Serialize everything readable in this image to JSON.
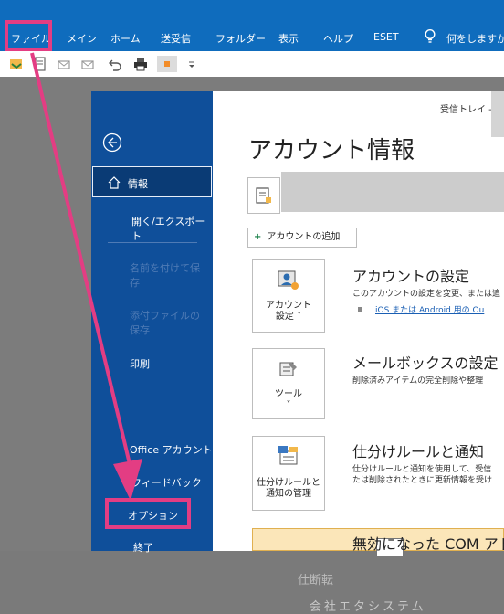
{
  "ribbon": {
    "tabs": [
      "ファイル",
      "メイン",
      "ホーム",
      "送受信",
      "フォルダー",
      "表示",
      "ヘルプ",
      "ESET"
    ],
    "tell_me": "何をしますか"
  },
  "backstage": {
    "inbox_crumb": "受信トレイ -",
    "nav": {
      "info": "情報",
      "open_export": "開く/エクスポート",
      "save_as": "名前を付けて保存",
      "save_attachments": "添付ファイルの保存",
      "print": "印刷",
      "office_account": "Office アカウント",
      "feedback": "フィードバック",
      "options": "オプション",
      "exit": "終了"
    },
    "title": "アカウント情報",
    "add_account": "アカウントの追加",
    "sections": [
      {
        "tile_label": "アカウント\n設定 ˅",
        "title": "アカウントの設定",
        "desc": "このアカウントの設定を変更、または追",
        "link": "iOS または Android 用の Ou"
      },
      {
        "tile_label": "ツール\n˅",
        "title": "メールボックスの設定",
        "desc": "削除済みアイテムの完全削除や整理"
      },
      {
        "tile_label": "仕分けルールと\n通知の管理",
        "title": "仕分けルールと通知",
        "desc": "仕分けルールと通知を使用して、受信",
        "desc2": "たは削除されたときに更新情報を受け"
      }
    ],
    "com_banner": "無効になった COM アド"
  },
  "watermark": {
    "line1": "仕断転",
    "line2": "会社エタシステム"
  },
  "colors": {
    "ribbon_blue": "#0f6cbd",
    "nav_blue": "#0f4f9a",
    "highlight_pink": "#e33d83"
  }
}
